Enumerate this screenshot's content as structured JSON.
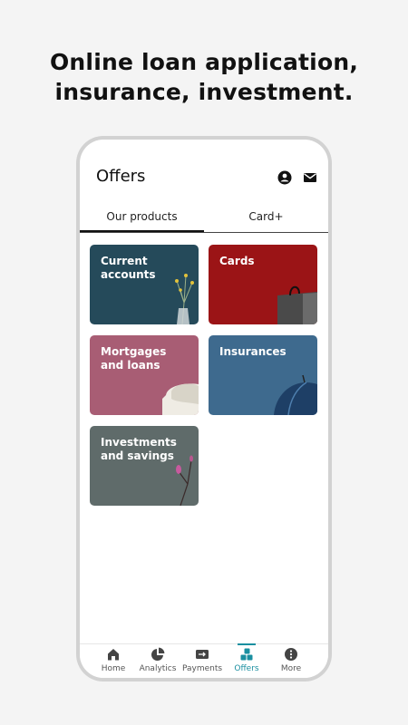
{
  "headline": {
    "line1": "Online loan application,",
    "line2": "insurance, investment."
  },
  "header": {
    "title": "Offers",
    "icons": [
      "account-icon",
      "mail-icon"
    ]
  },
  "tabs": [
    {
      "label": "Our products",
      "active": true
    },
    {
      "label": "Card+",
      "active": false
    }
  ],
  "products": [
    {
      "label": "Current\naccounts",
      "color": "#254a5a"
    },
    {
      "label": "Cards",
      "color": "#9b1416"
    },
    {
      "label": "Mortgages\nand loans",
      "color": "#a85d74"
    },
    {
      "label": "Insurances",
      "color": "#3e6a8e"
    },
    {
      "label": "Investments\nand savings",
      "color": "#5f6b6a"
    }
  ],
  "bottom_nav": [
    {
      "label": "Home",
      "icon": "home-icon",
      "active": false
    },
    {
      "label": "Analytics",
      "icon": "pie-chart-icon",
      "active": false
    },
    {
      "label": "Payments",
      "icon": "payments-icon",
      "active": false
    },
    {
      "label": "Offers",
      "icon": "offers-icon",
      "active": true
    },
    {
      "label": "More",
      "icon": "more-icon",
      "active": false
    }
  ],
  "colors": {
    "accent": "#1a8fa0",
    "background": "#f4f4f4"
  }
}
